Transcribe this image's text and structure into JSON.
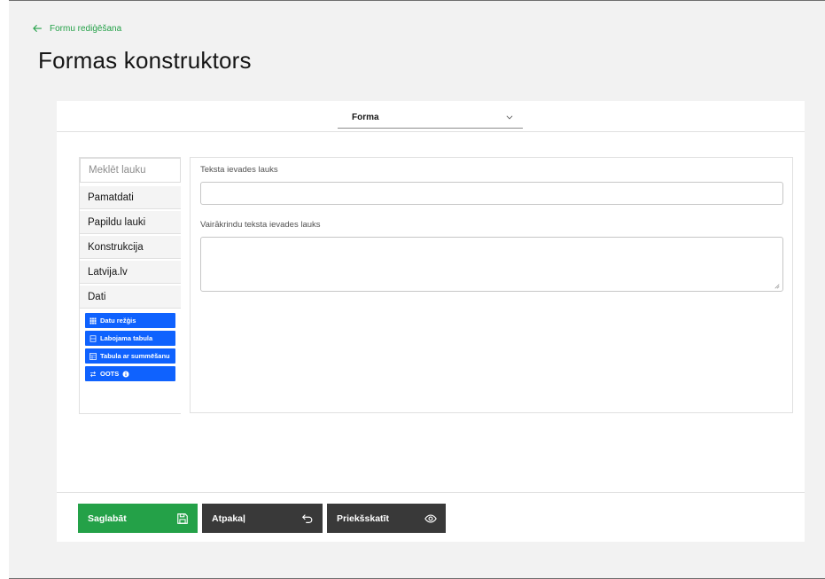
{
  "header": {
    "back_label": "Formu rediģēšana",
    "title": "Formas konstruktors"
  },
  "form_selector": {
    "value": "Forma"
  },
  "sidebar": {
    "search_placeholder": "Meklēt lauku",
    "categories": [
      "Pamatdati",
      "Papildu lauki",
      "Konstrukcija",
      "Latvija.lv",
      "Dati"
    ],
    "tools": [
      {
        "label": "Datu režģis",
        "icon": "grid-icon"
      },
      {
        "label": "Labojama tabula",
        "icon": "rows-icon"
      },
      {
        "label": "Tabula ar summēšanu",
        "icon": "table-sum-icon"
      },
      {
        "label": "OOTS",
        "icon": "swap-icon",
        "badge_icon": "info-icon"
      }
    ]
  },
  "canvas": {
    "fields": [
      {
        "label": "Teksta ievades lauks",
        "value": ""
      },
      {
        "label": "Vairākrindu teksta ievades lauks",
        "value": ""
      }
    ]
  },
  "footer": {
    "save_label": "Saglabāt",
    "back_label": "Atpakaļ",
    "preview_label": "Priekšskatīt"
  },
  "colors": {
    "accent_green": "#24a148",
    "tool_blue": "#0f62fe",
    "dark_button": "#393939",
    "page_bg": "#f2f2f2"
  }
}
